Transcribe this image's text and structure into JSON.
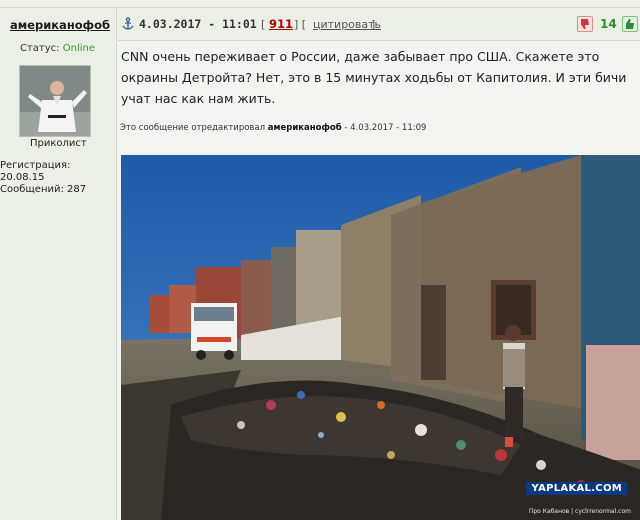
{
  "author": {
    "nickname": "американофоб",
    "status_label": "Статус:",
    "status_value": "Online",
    "rank": "Приколист",
    "registration": "Регистрация: 20.08.15",
    "messages": "Сообщений: 287"
  },
  "post": {
    "date": "4.03.2017 - 11:01",
    "post_number": "911",
    "quote_label": "цитировать",
    "rating": "14",
    "text": "CNN очень переживает о России, даже забывает про США. Скажете это окраины Детройта? Нет, это в 15 минутах ходьбы от Капитолия. И эти бичи учат нас как нам жить.",
    "edited_prefix": "Это сообщение отредактировал",
    "edited_user": "американофоб",
    "edited_time": "- 4.03.2017 - 11:09",
    "watermark": "YAPLAKAL.COM",
    "photo_credit": "Про Кабанов | cyclrrenormal.com"
  },
  "colors": {
    "online": "#2e9a2e",
    "post_number": "#b00000",
    "rating": "#2e8b2e",
    "watermark_bg": "#0c3a82"
  }
}
